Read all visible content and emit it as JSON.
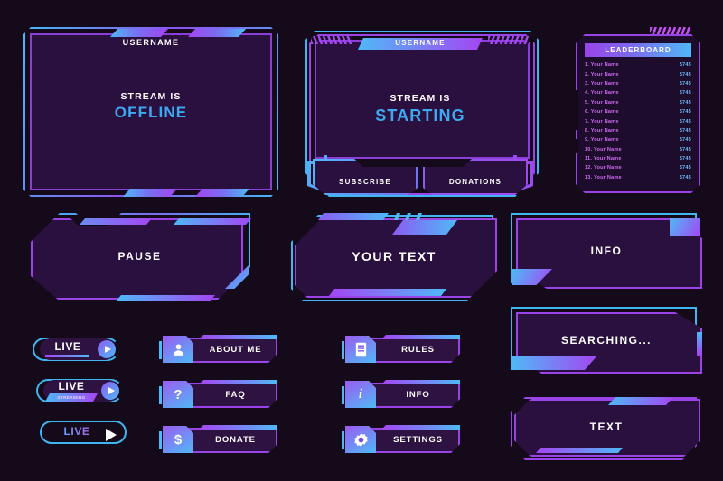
{
  "theme": {
    "background": "#150a1a",
    "panel_fill": "#2a103f",
    "accent_blue": "#4fb9f7",
    "accent_purple": "#a445f2",
    "border_purple": "#9a44e8",
    "text_white": "#ffffff",
    "text_blue": "#3ea8f0",
    "leaderboard_name": "#cf6bf0",
    "leaderboard_value": "#6ab8f2"
  },
  "offline_panel": {
    "username": "USERNAME",
    "status_line1": "STREAM IS",
    "status_line2": "OFFLINE"
  },
  "starting_panel": {
    "username": "USERNAME",
    "status_line1": "STREAM IS",
    "status_line2": "STARTING",
    "buttons": [
      {
        "label": "SUBSCRIBE"
      },
      {
        "label": "DONATIONS"
      }
    ]
  },
  "leaderboard": {
    "title": "LEADERBOARD",
    "rows": [
      {
        "name": "1. Your Name",
        "value": "$745"
      },
      {
        "name": "2. Your Name",
        "value": "$745"
      },
      {
        "name": "3. Your Name",
        "value": "$745"
      },
      {
        "name": "4. Your Name",
        "value": "$745"
      },
      {
        "name": "5. Your Name",
        "value": "$745"
      },
      {
        "name": "6. Your Name",
        "value": "$745"
      },
      {
        "name": "7. Your Name",
        "value": "$745"
      },
      {
        "name": "8. Your Name",
        "value": "$745"
      },
      {
        "name": "9. Your Name",
        "value": "$745"
      },
      {
        "name": "10. Your Name",
        "value": "$745"
      },
      {
        "name": "11. Your Name",
        "value": "$745"
      },
      {
        "name": "12. Your Name",
        "value": "$745"
      },
      {
        "name": "13. Your Name",
        "value": "$745"
      }
    ]
  },
  "pause_panel": {
    "label": "PAUSE"
  },
  "yourtext_panel": {
    "label": "YOUR TEXT"
  },
  "info_panel": {
    "label": "INFO"
  },
  "searching_panel": {
    "label": "SEARCHING..."
  },
  "text_panel": {
    "label": "TEXT"
  },
  "live_badges": [
    {
      "label": "LIVE",
      "sub": "",
      "icon": "play-icon"
    },
    {
      "label": "LIVE",
      "sub": "STREAMING",
      "icon": "play-icon"
    },
    {
      "label": "LIVE",
      "sub": "",
      "icon": "play-icon"
    }
  ],
  "buttons_left": [
    {
      "label": "ABOUT ME",
      "icon": "person-icon",
      "glyph": "♟"
    },
    {
      "label": "FAQ",
      "icon": "question-mark-icon",
      "glyph": "?"
    },
    {
      "label": "DONATE",
      "icon": "dollar-icon",
      "glyph": "$"
    }
  ],
  "buttons_right": [
    {
      "label": "RULES",
      "icon": "document-icon",
      "glyph": "☰"
    },
    {
      "label": "INFO",
      "icon": "information-icon",
      "glyph": "i"
    },
    {
      "label": "SETTINGS",
      "icon": "gear-icon",
      "glyph": "⚙"
    }
  ]
}
